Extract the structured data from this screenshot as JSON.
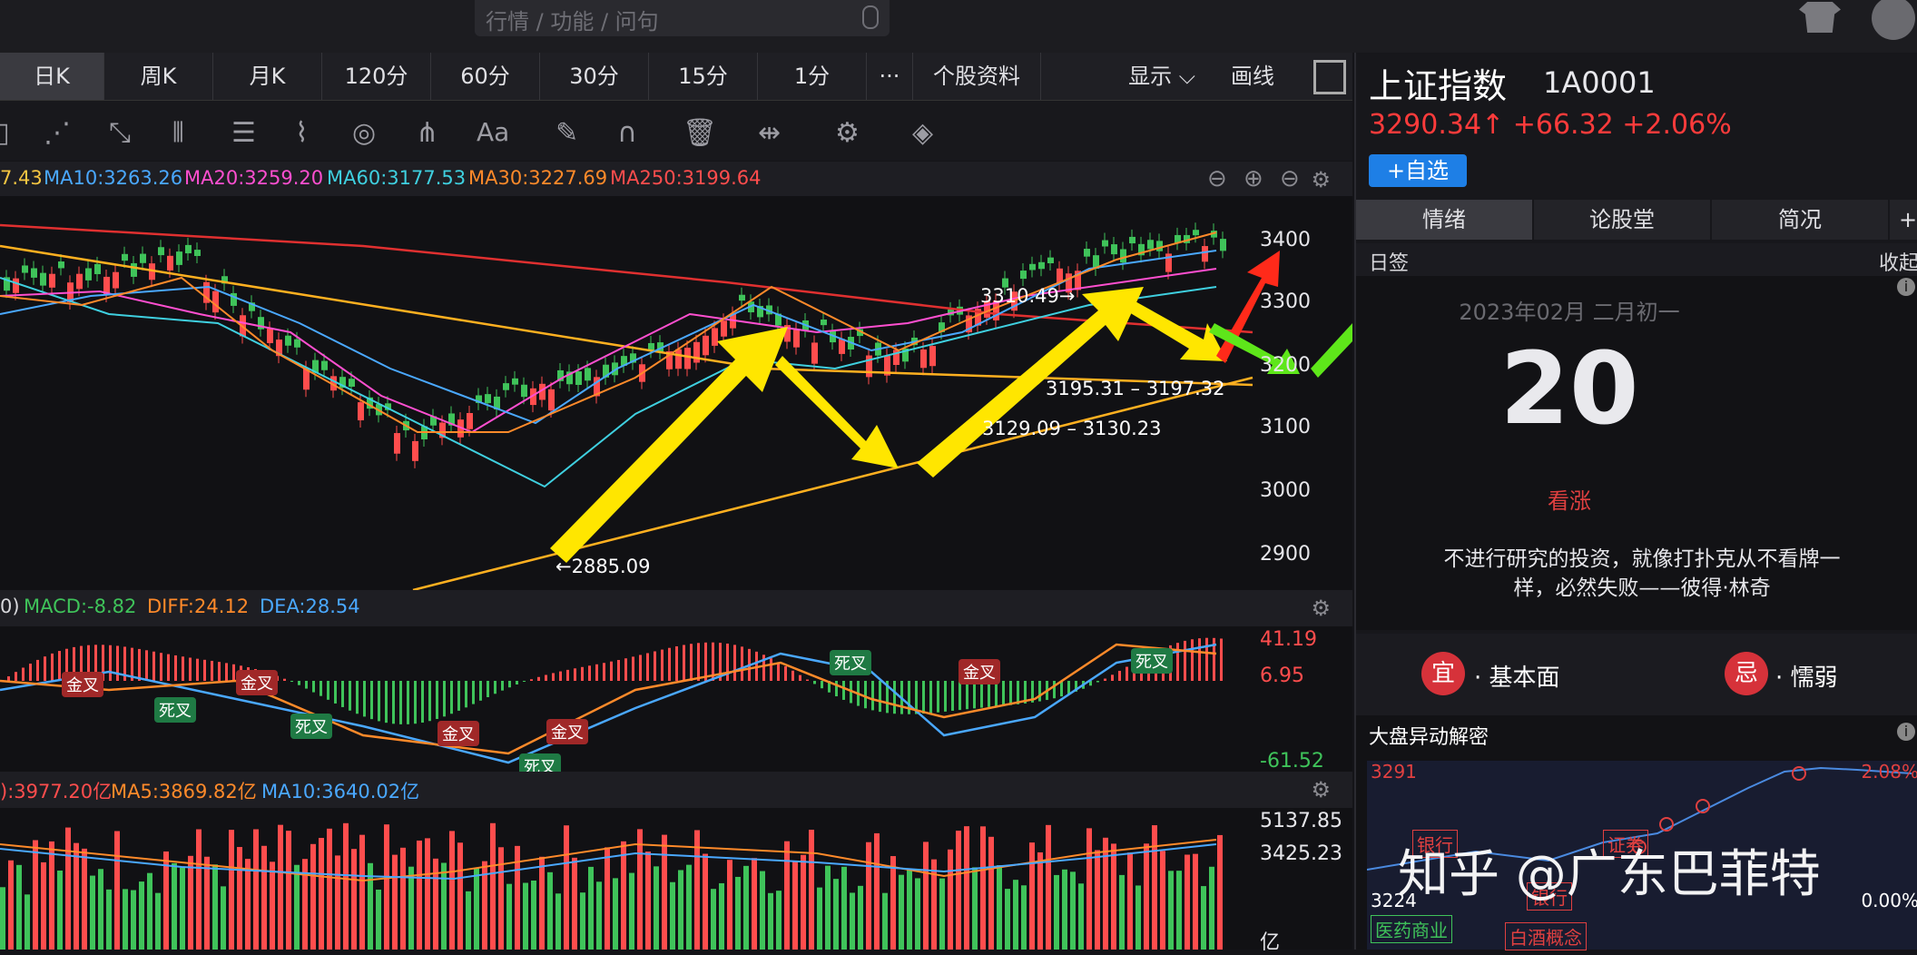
{
  "search": {
    "placeholder": "行情 / 功能 / 问句"
  },
  "icons": {
    "mic": "mic-icon",
    "shirt": "shirt-icon",
    "avatar": "avatar-icon"
  },
  "tabs": [
    {
      "label": "日K"
    },
    {
      "label": "周K"
    },
    {
      "label": "月K"
    },
    {
      "label": "120分"
    },
    {
      "label": "60分"
    },
    {
      "label": "30分"
    },
    {
      "label": "15分"
    },
    {
      "label": "1分"
    },
    {
      "label": "···"
    },
    {
      "label": "个股资料"
    }
  ],
  "tab_right": {
    "display": "显示",
    "draw": "画线"
  },
  "ma_labels": [
    {
      "text": "7.43",
      "color": "#f5c542"
    },
    {
      "text": "MA10:3263.26",
      "color": "#4aa8ff"
    },
    {
      "text": "MA20:3259.20",
      "color": "#ff4fd0"
    },
    {
      "text": "MA60:3177.53",
      "color": "#3fd0e0"
    },
    {
      "text": "MA30:3227.69",
      "color": "#ff8a2a"
    },
    {
      "text": "MA250:3199.64",
      "color": "#ff4d4d"
    }
  ],
  "price_axis": [
    "3400",
    "3300",
    "3200",
    "3100",
    "3000",
    "2900"
  ],
  "annotations": {
    "high": "3310.49→",
    "low": "←2885.09",
    "range1": "3195.31 – 3197.32",
    "range2": "3129.09 – 3130.23"
  },
  "macd_labels": [
    {
      "text": "0)",
      "color": "#d8d8dc"
    },
    {
      "text": "MACD:-8.82",
      "color": "#3fc35a"
    },
    {
      "text": "DIFF:24.12",
      "color": "#ff8a2a"
    },
    {
      "text": "DEA:28.54",
      "color": "#4aa8ff"
    }
  ],
  "macd_axis": {
    "top": "41.19",
    "mid": "6.95",
    "bottom": "-61.52"
  },
  "cross_tags": [
    {
      "text": "金叉",
      "kind": "gold"
    },
    {
      "text": "死叉",
      "kind": "dead"
    },
    {
      "text": "金叉",
      "kind": "gold"
    },
    {
      "text": "死叉",
      "kind": "dead"
    },
    {
      "text": "金叉",
      "kind": "gold"
    },
    {
      "text": "金叉",
      "kind": "gold"
    },
    {
      "text": "死叉",
      "kind": "dead"
    },
    {
      "text": "死叉",
      "kind": "dead"
    },
    {
      "text": "金叉",
      "kind": "gold"
    },
    {
      "text": "死叉",
      "kind": "dead"
    }
  ],
  "vol_labels": [
    {
      "text": "):3977.20亿",
      "color": "#ff4d4d"
    },
    {
      "text": "MA5:3869.82亿",
      "color": "#ff8a2a"
    },
    {
      "text": "MA10:3640.02亿",
      "color": "#4aa8ff"
    }
  ],
  "vol_axis": {
    "top": "5137.85",
    "mid": "3425.23",
    "unit": "亿"
  },
  "panel": {
    "name": "上证指数",
    "code": "1A0001",
    "price": "3290.34↑ +66.32 +2.06%",
    "fav": "+自选",
    "tabs": [
      "情绪",
      "论股堂",
      "简况"
    ],
    "plus": "+",
    "sign_left": "日签",
    "sign_right": "收起",
    "info": "i",
    "date": "2023年02月 二月初一",
    "score": "20",
    "mood": "看涨",
    "quote": "不进行研究的投资，就像打扑克从不看牌一样，必然失败——彼得·林奇",
    "yi_badge": "宜",
    "yi_text": "· 基本面",
    "ji_badge": "忌",
    "ji_text": "· 懦弱",
    "dapan_title": "大盘异动解密",
    "dapan_top": "3291",
    "dapan_bottom": "3224",
    "dapan_pct_top": "2.08%",
    "dapan_pct_bottom": "0.00%",
    "boxes": [
      "银行",
      "证券",
      "银行",
      "医药商业",
      "白酒概念"
    ]
  },
  "watermark": "知乎 @广东巴菲特",
  "colors": {
    "up": "#ff4d4d",
    "down": "#3fc35a",
    "arrow_yellow": "#ffe600",
    "arrow_red": "#ff2a1a",
    "arrow_green": "#5ee61a"
  }
}
